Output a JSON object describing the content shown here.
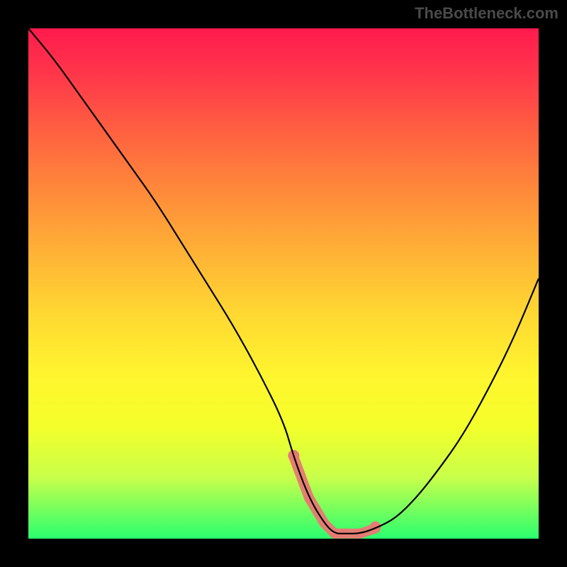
{
  "watermark": "TheBottleneck.com",
  "chart_data": {
    "type": "line",
    "title": "",
    "xlabel": "",
    "ylabel": "",
    "xlim": [
      0,
      100
    ],
    "ylim": [
      0,
      100
    ],
    "x": [
      0,
      5,
      10,
      15,
      20,
      25,
      30,
      35,
      40,
      45,
      50,
      52,
      55,
      58,
      60,
      62,
      65,
      68,
      72,
      76,
      80,
      85,
      90,
      95,
      100
    ],
    "values": [
      100,
      94,
      87,
      80,
      73,
      66,
      58,
      50,
      42,
      33,
      23,
      16,
      8,
      3,
      1,
      1,
      1,
      2,
      4,
      8,
      13,
      20,
      29,
      39,
      51
    ],
    "annotations": [
      {
        "text": "",
        "x_range": [
          52,
          68
        ],
        "note": "pink-band-near-minimum"
      }
    ]
  },
  "colors": {
    "curve": "#000000",
    "band": "#e77a74",
    "frame": "#000000"
  }
}
